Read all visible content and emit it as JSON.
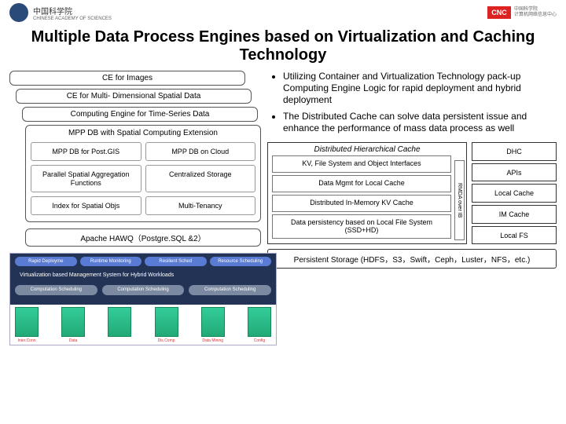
{
  "header": {
    "left_org_ch": "中国科学院",
    "left_org_en": "CHINESE ACADEMY OF SCIENCES",
    "right_mark": "CNC",
    "right_text_line1": "中国科学院",
    "right_text_line2": "计算机网络信息中心"
  },
  "title": "Multiple Data Process Engines based on Virtualization and Caching Technology",
  "stack": {
    "ce_images": "CE for Images",
    "ce_multi": "CE for Multi- Dimensional Spatial Data",
    "ce_time": "Computing Engine for Time-Series Data",
    "mpp_head": "MPP DB with Spatial Computing Extension",
    "cells": [
      "MPP DB for Post.GIS",
      "MPP DB on Cloud",
      "Parallel Spatial Aggregation Functions",
      "Centralized Storage",
      "Index for Spatial Objs",
      "Multi-Tenancy"
    ],
    "hawq": "Apache HAWQ（Postgre.SQL &2）"
  },
  "chart": {
    "row1": [
      "Rapid Deployme",
      "Runtime Monitoring",
      "Resilient Sched",
      "Resource Scheduling"
    ],
    "vis_label": "Virtualization based Management System for Hybrid Workloads",
    "row2": [
      "Computation Scheduling",
      "Computation Scheduling",
      "Computation Scheduling"
    ],
    "srv_labels": [
      "Inter.Conn",
      "Data",
      "",
      "Dis.Comp",
      "Data Mining",
      "Config"
    ]
  },
  "bullets": [
    "Utilizing Container and Virtualization Technology pack-up Computing Engine Logic for rapid deployment and hybrid deployment",
    "The Distributed Cache can solve data persistent issue and enhance the performance of  mass data process as well"
  ],
  "dhc": {
    "head": "Distributed Hierarchical Cache",
    "rows": [
      "KV, File System and Object Interfaces",
      "Data Mgmt for Local Cache",
      "Distributed In-Memory KV Cache",
      "Data persistency based on Local File System (SSD+HD)"
    ],
    "side": "RMDA over IB",
    "right": [
      "DHC",
      "APIs",
      "Local Cache",
      "IM Cache",
      "Local FS"
    ]
  },
  "persist": "Persistent Storage (HDFS，S3，Swift，Ceph，Luster，NFS，etc.)"
}
